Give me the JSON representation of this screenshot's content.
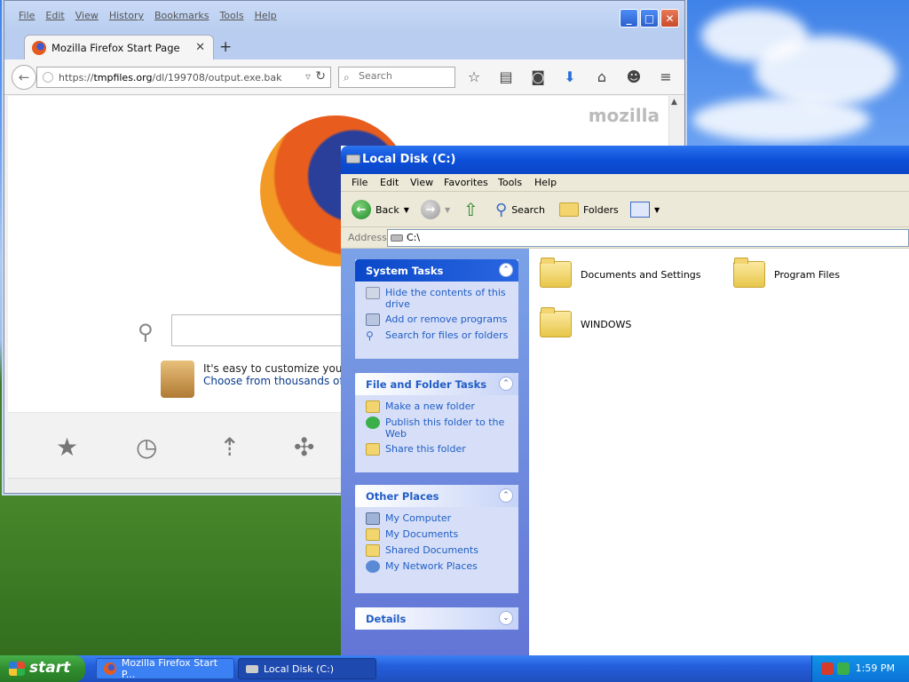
{
  "firefox": {
    "menu": [
      "File",
      "Edit",
      "View",
      "History",
      "Bookmarks",
      "Tools",
      "Help"
    ],
    "tab_title": "Mozilla Firefox Start Page",
    "url_prefix": "https://",
    "url_host": "tmpfiles.org",
    "url_path": "/dl/199708/output.exe.bak",
    "search_placeholder": "Search",
    "brand": "mozilla",
    "customize_line1": "It's easy to customize your Fi",
    "customize_line2": "Choose from thousands of ac"
  },
  "explorer": {
    "title": "Local Disk (C:)",
    "menu": [
      "File",
      "Edit",
      "View",
      "Favorites",
      "Tools",
      "Help"
    ],
    "toolbar": {
      "back": "Back",
      "search": "Search",
      "folders": "Folders"
    },
    "address_label": "Address",
    "address_value": "C:\\",
    "system_tasks": {
      "title": "System Tasks",
      "items": [
        "Hide the contents of this drive",
        "Add or remove programs",
        "Search for files or folders"
      ]
    },
    "file_tasks": {
      "title": "File and Folder Tasks",
      "items": [
        "Make a new folder",
        "Publish this folder to the Web",
        "Share this folder"
      ]
    },
    "other_places": {
      "title": "Other Places",
      "items": [
        "My Computer",
        "My Documents",
        "Shared Documents",
        "My Network Places"
      ]
    },
    "details": {
      "title": "Details"
    },
    "folders": [
      "Documents and Settings",
      "Program Files",
      "WINDOWS"
    ]
  },
  "taskbar": {
    "start": "start",
    "tasks": [
      "Mozilla Firefox Start P...",
      "Local Disk (C:)"
    ],
    "clock": "1:59 PM"
  }
}
